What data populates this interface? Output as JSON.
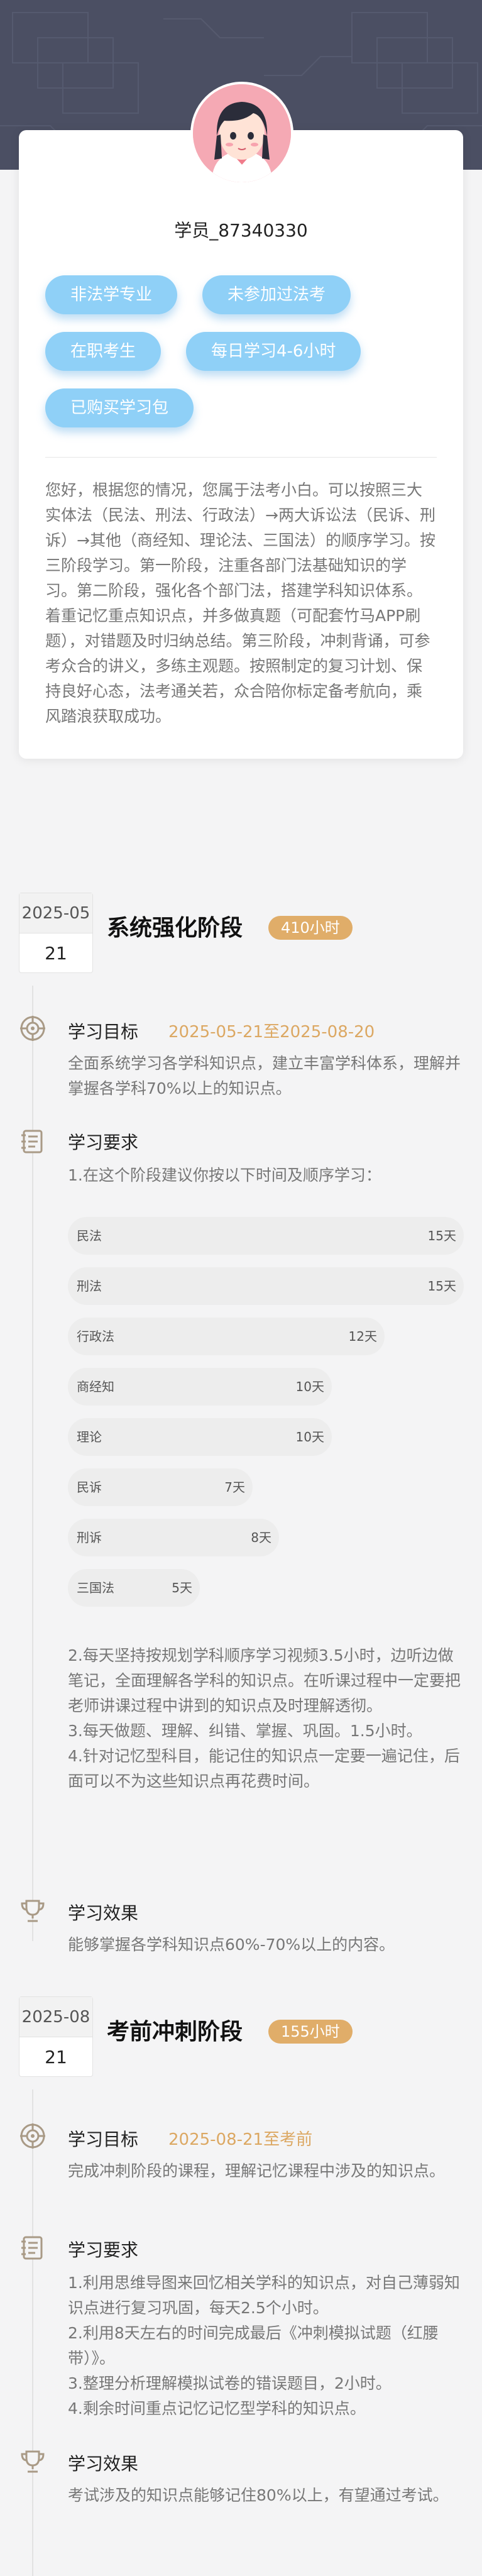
{
  "profile": {
    "username": "学员_87340330",
    "tags": [
      "非法学专业",
      "未参加过法考",
      "在职考生",
      "每日学习4-6小时",
      "已购买学习包"
    ],
    "intro": "您好，根据您的情况，您属于法考小白。可以按照三大实体法（民法、刑法、行政法）→两大诉讼法（民诉、刑诉）→其他（商经知、理论法、三国法）的顺序学习。按三阶段学习。第一阶段，注重各部门法基础知识的学习。第二阶段，强化各个部门法，搭建学科知识体系。着重记忆重点知识点，并多做真题（可配套竹马APP刷题），对错题及时归纳总结。第三阶段，冲刺背诵，可参考众合的讲义，多练主观题。按照制定的复习计划、保持良好心态，法考通关若，众合陪你标定备考航向，乘风踏浪获取成功。"
  },
  "stages": [
    {
      "date_ym": "2025-05",
      "date_d": "21",
      "title": "系统强化阶段",
      "hours": "410小时",
      "goal_label": "学习目标",
      "goal_range": "2025-05-21至2025-08-20",
      "goal_text": "全面系统学习各学科知识点，建立丰富学科体系，理解并掌握各学科70%以上的知识点。",
      "req_label": "学习要求",
      "req_intro": "1.在这个阶段建议你按以下时间及顺序学习：",
      "subjects": [
        {
          "name": "民法",
          "days": "15天",
          "value": 15
        },
        {
          "name": "刑法",
          "days": "15天",
          "value": 15
        },
        {
          "name": "行政法",
          "days": "12天",
          "value": 12
        },
        {
          "name": "商经知",
          "days": "10天",
          "value": 10
        },
        {
          "name": "理论",
          "days": "10天",
          "value": 10
        },
        {
          "name": "民诉",
          "days": "7天",
          "value": 7
        },
        {
          "name": "刑诉",
          "days": "8天",
          "value": 8
        },
        {
          "name": "三国法",
          "days": "5天",
          "value": 5
        }
      ],
      "req_more": [
        "2.每天坚持按规划学科顺序学习视频3.5小时，边听边做笔记，全面理解各学科的知识点。在听课过程中一定要把老师讲课过程中讲到的知识点及时理解透彻。",
        "3.每天做题、理解、纠错、掌握、巩固。1.5小时。",
        "4.针对记忆型科目，能记住的知识点一定要一遍记住，后面可以不为这些知识点再花费时间。"
      ],
      "effect_label": "学习效果",
      "effect_text": "能够掌握各学科知识点60%-70%以上的内容。"
    },
    {
      "date_ym": "2025-08",
      "date_d": "21",
      "title": "考前冲刺阶段",
      "hours": "155小时",
      "goal_label": "学习目标",
      "goal_range": "2025-08-21至考前",
      "goal_text": "完成冲刺阶段的课程，理解记忆课程中涉及的知识点。",
      "req_label": "学习要求",
      "req_more": [
        "1.利用思维导图来回忆相关学科的知识点，对自己薄弱知识点进行复习巩固，每天2.5个小时。",
        "2.利用8天左右的时间完成最后《冲刺模拟试题（红腰带）》。",
        "3.整理分析理解模拟试卷的错误题目，2小时。",
        "4.剩余时间重点记忆记忆型学科的知识点。"
      ],
      "effect_label": "学习效果",
      "effect_text": "考试涉及的知识点能够记住80%以上，有望通过考试。"
    }
  ]
}
